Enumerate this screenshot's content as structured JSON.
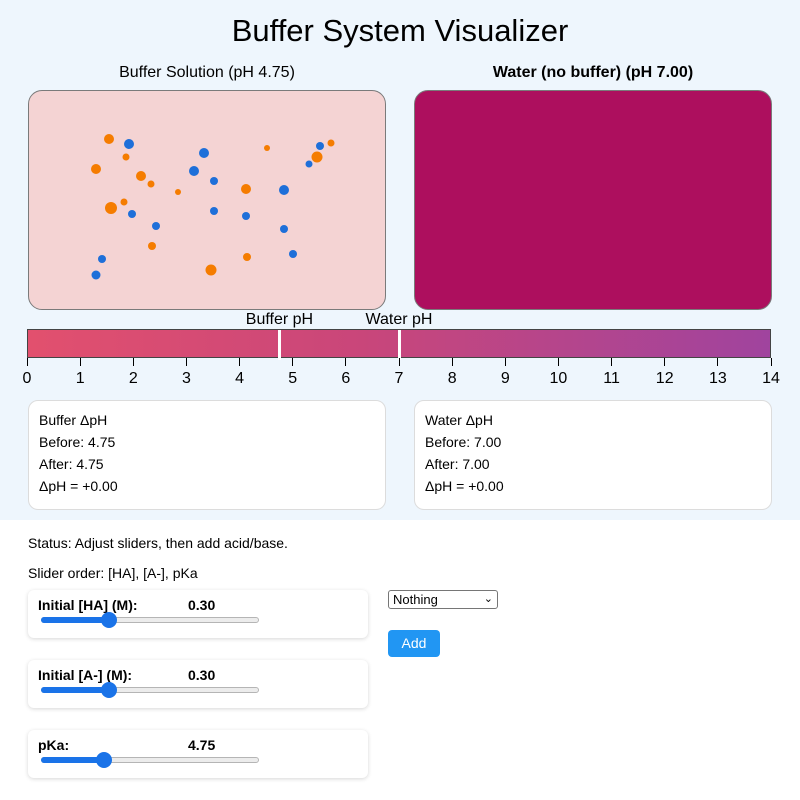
{
  "app": {
    "title": "Buffer System Visualizer"
  },
  "buffer_panel": {
    "title": "Buffer Solution (pH 4.75)",
    "fill_color": "#f4d3d3",
    "particles": [
      {
        "species": "A-",
        "color": "#f57c00"
      },
      {
        "species": "HA",
        "color": "#1e6fd9"
      }
    ]
  },
  "water_panel": {
    "title": "Water (no buffer) (pH 7.00)",
    "fill_color": "#ad0f5e"
  },
  "ph_scale": {
    "min": 0,
    "max": 14,
    "ticks": [
      "0",
      "1",
      "2",
      "3",
      "4",
      "5",
      "6",
      "7",
      "8",
      "9",
      "10",
      "11",
      "12",
      "13",
      "14"
    ],
    "buffer_marker": {
      "label": "Buffer pH",
      "value": 4.75
    },
    "water_marker": {
      "label": "Water pH",
      "value": 7.0
    }
  },
  "buffer_card": {
    "title": "Buffer ΔpH",
    "before": "Before: 4.75",
    "after": "After: 4.75",
    "delta": "ΔpH = +0.00"
  },
  "water_card": {
    "title": "Water ΔpH",
    "before": "Before: 7.00",
    "after": "After: 7.00",
    "delta": "ΔpH = +0.00"
  },
  "status": "Status: Adjust sliders, then add acid/base.",
  "slider_order": "Slider order: [HA], [A-], pKa",
  "sliders": [
    {
      "label": "Initial [HA] (M):",
      "value": "0.30",
      "level": 0.31
    },
    {
      "label": "Initial [A-] (M):",
      "value": "0.30",
      "level": 0.31
    },
    {
      "label": "pKa:",
      "value": "4.75",
      "level": 0.29
    }
  ],
  "additive_select": {
    "selected": "Nothing"
  },
  "add_button": {
    "label": "Add"
  }
}
